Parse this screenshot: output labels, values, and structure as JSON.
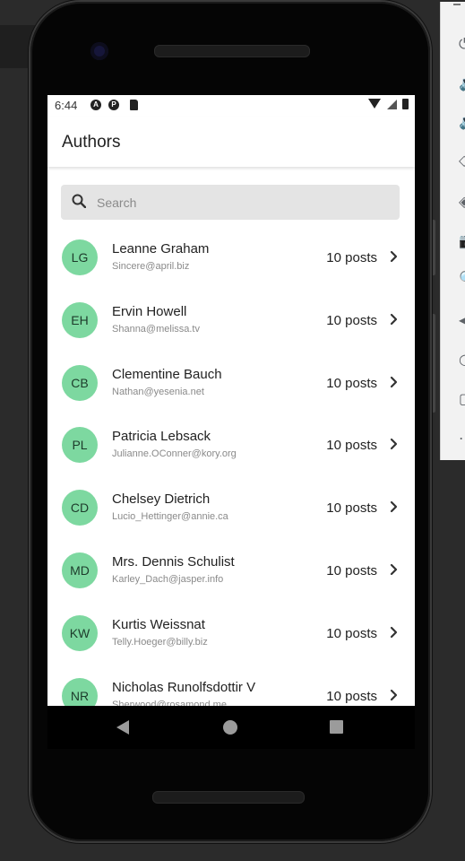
{
  "status_bar": {
    "time": "6:44",
    "icons": [
      "a-icon",
      "p-icon",
      "sd-card-icon",
      "wifi-icon",
      "signal-icon",
      "battery-icon"
    ]
  },
  "app_bar": {
    "title": "Authors"
  },
  "search": {
    "placeholder": "Search",
    "value": ""
  },
  "colors": {
    "avatar": "#7dd8a0",
    "search_bg": "#e4e4e4",
    "text": "#222222",
    "secondary": "#8a8a8a"
  },
  "authors": [
    {
      "initials": "LG",
      "name": "Leanne Graham",
      "email": "Sincere@april.biz",
      "posts": "10 posts"
    },
    {
      "initials": "EH",
      "name": "Ervin Howell",
      "email": "Shanna@melissa.tv",
      "posts": "10 posts"
    },
    {
      "initials": "CB",
      "name": "Clementine Bauch",
      "email": "Nathan@yesenia.net",
      "posts": "10 posts"
    },
    {
      "initials": "PL",
      "name": "Patricia Lebsack",
      "email": "Julianne.OConner@kory.org",
      "posts": "10 posts"
    },
    {
      "initials": "CD",
      "name": "Chelsey Dietrich",
      "email": "Lucio_Hettinger@annie.ca",
      "posts": "10 posts"
    },
    {
      "initials": "MD",
      "name": "Mrs. Dennis Schulist",
      "email": "Karley_Dach@jasper.info",
      "posts": "10 posts"
    },
    {
      "initials": "KW",
      "name": "Kurtis Weissnat",
      "email": "Telly.Hoeger@billy.biz",
      "posts": "10 posts"
    },
    {
      "initials": "NR",
      "name": "Nicholas Runolfsdottir V",
      "email": "Sherwood@rosamond.me",
      "posts": "10 posts"
    }
  ],
  "nav_bar": {
    "buttons": [
      "back-icon",
      "home-icon",
      "recents-icon"
    ]
  },
  "emulator_toolbar": {
    "glyphs": [
      "⏻",
      "🔊",
      "🔉",
      "◇",
      "◈",
      "📷",
      "🔍",
      "◀",
      "○",
      "▢",
      "⋯"
    ]
  }
}
